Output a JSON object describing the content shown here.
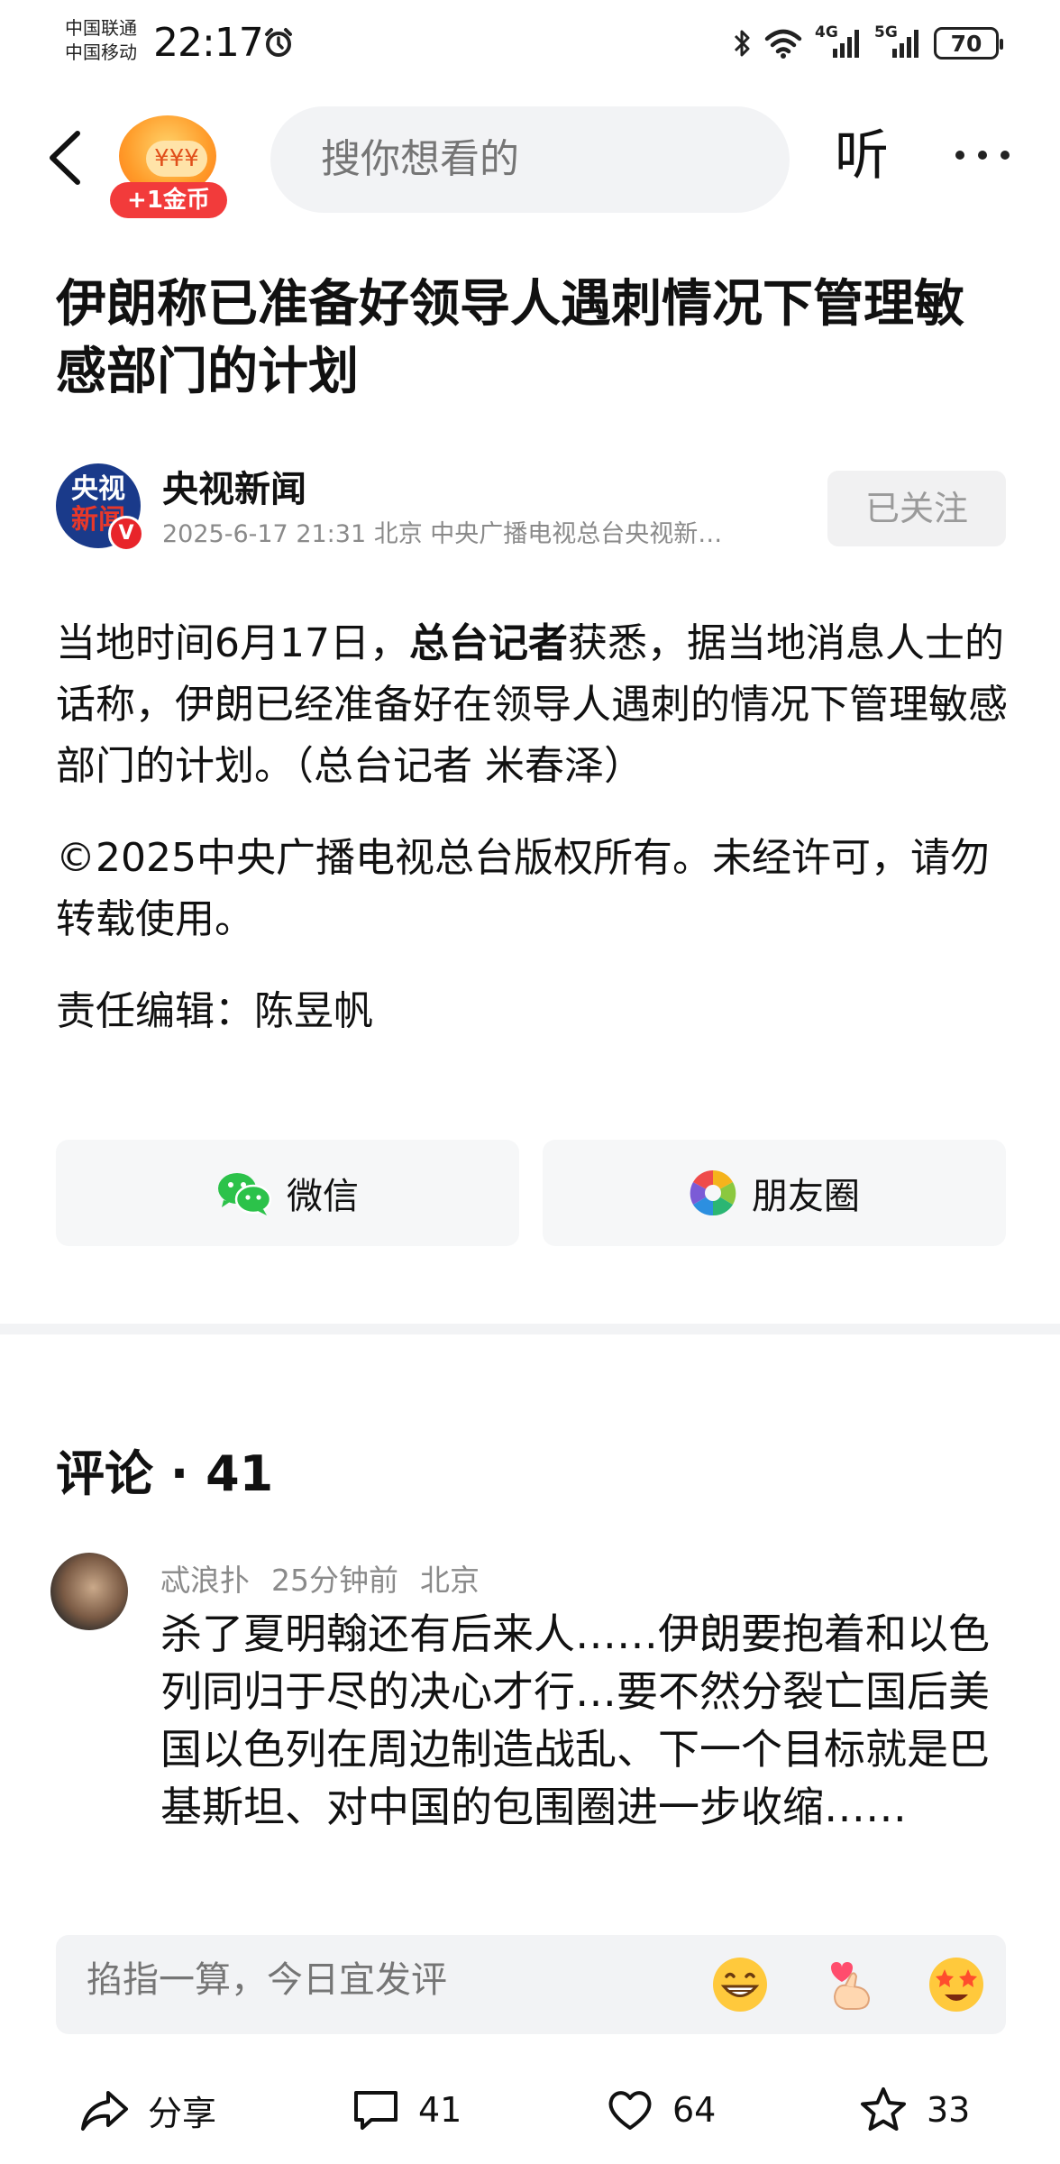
{
  "status_bar": {
    "carrier1": "中国联通",
    "carrier2": "中国移动",
    "time": "22:17",
    "network1": "4G",
    "network2": "5G",
    "battery": "70"
  },
  "nav": {
    "coin_label": "+1金币",
    "search_placeholder": "搜你想看的",
    "listen_label": "听"
  },
  "article": {
    "title": "伊朗称已准备好领导人遇刺情况下管理敏感部门的计划",
    "author": "央视新闻",
    "author_logo_line1": "央视",
    "author_logo_line2": "新闻",
    "meta": "2025-6-17  21:31  北京  中央广播电视总台央视新…",
    "follow_label": "已关注",
    "para1_pre": "当地时间6月17日，",
    "para1_bold": "总台记者",
    "para1_post": "获悉，据当地消息人士的话称，伊朗已经准备好在领导人遇刺的情况下管理敏感部门的计划。（总台记者 米春泽）",
    "copyright": "©2025中央广播电视总台版权所有。未经许可，请勿转载使用。",
    "editor": "责任编辑：陈昱帆"
  },
  "share": {
    "wechat": "微信",
    "moments": "朋友圈"
  },
  "comments": {
    "header": "评论 · 41",
    "items": [
      {
        "user": "忒浪扑",
        "time": "25分钟前",
        "location": "北京",
        "text": "杀了夏明翰还有后来人……伊朗要抱着和以色列同归于尽的决心才行…要不然分裂亡国后美国以色列在周边制造战乱、下一个目标就是巴基斯坦、对中国的包围圈进一步收缩……"
      }
    ]
  },
  "input_bar": {
    "placeholder": "掐指一算，今日宜发评"
  },
  "bottom_bar": {
    "share_label": "分享",
    "comment_count": "41",
    "like_count": "64",
    "fav_count": "33"
  }
}
